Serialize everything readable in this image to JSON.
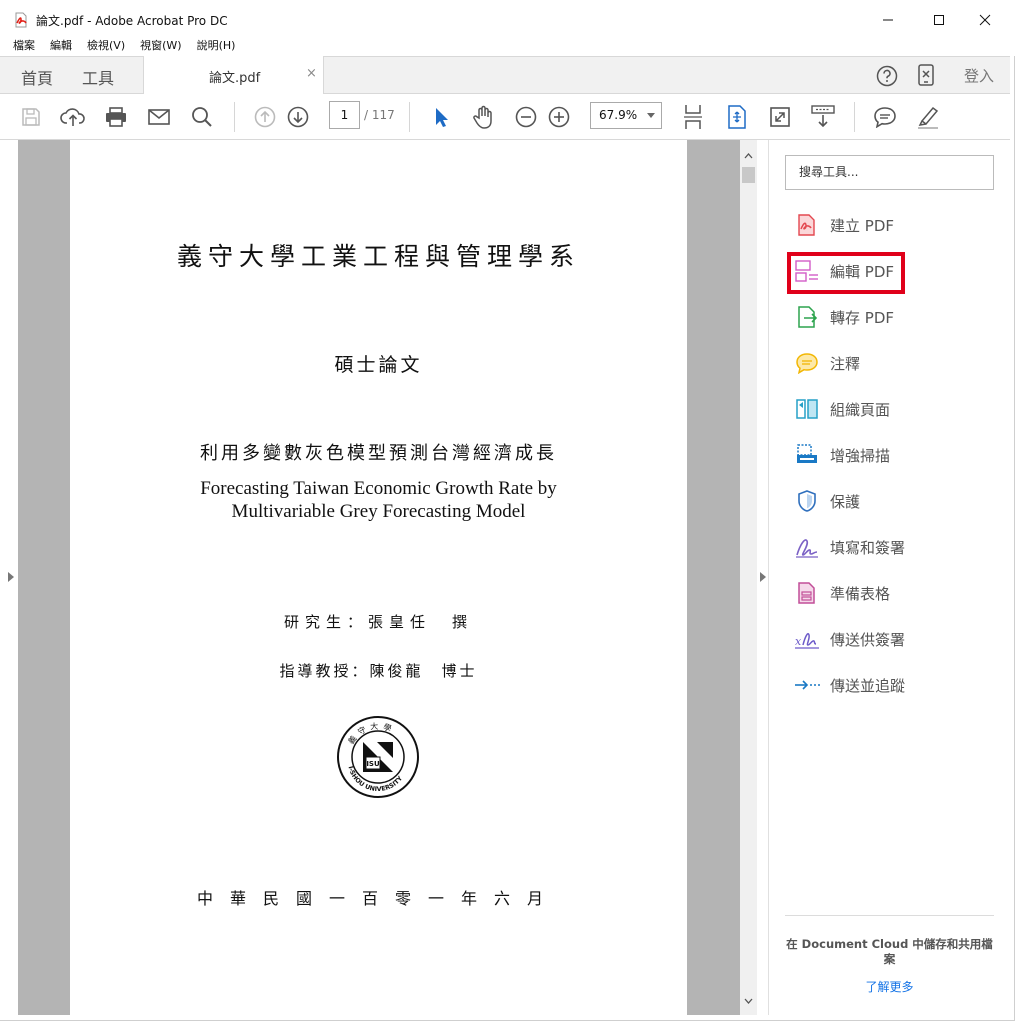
{
  "window": {
    "title": "論文.pdf - Adobe Acrobat Pro DC"
  },
  "menu": [
    "檔案",
    "編輯",
    "檢視(V)",
    "視窗(W)",
    "說明(H)"
  ],
  "tabs": {
    "home": "首頁",
    "tools": "工具",
    "document": "論文.pdf",
    "close": "×",
    "signin": "登入"
  },
  "toolbar": {
    "page_current": "1",
    "page_total": "/ 117",
    "zoom": "67.9%"
  },
  "document": {
    "university": "義守大學工業工程與管理學系",
    "thesis_type": "碩士論文",
    "title_zh": "利用多變數灰色模型預測台灣經濟成長",
    "title_en_line1": "Forecasting Taiwan Economic Growth Rate by",
    "title_en_line2": "Multivariable Grey Forecasting Model",
    "student": "研究生：張皇任　撰",
    "advisor": "指導教授：陳俊龍　博士",
    "date": "中華民國一百零一年六月",
    "seal": {
      "top_text": "義 守 大 學",
      "center_text": "ISU",
      "bottom_text": "I-SHOU UNIVERSITY"
    }
  },
  "tools_pane": {
    "search_placeholder": "搜尋工具...",
    "items": [
      {
        "label": "建立 PDF",
        "icon": "create-pdf-icon",
        "color": "#e34850"
      },
      {
        "label": "編輯 PDF",
        "icon": "edit-pdf-icon",
        "color": "#d25cc8"
      },
      {
        "label": "轉存 PDF",
        "icon": "export-pdf-icon",
        "color": "#2da44e"
      },
      {
        "label": "注釋",
        "icon": "comment-icon",
        "color": "#f2b705"
      },
      {
        "label": "組織頁面",
        "icon": "organize-pages-icon",
        "color": "#26a0c7"
      },
      {
        "label": "增強掃描",
        "icon": "enhance-scan-icon",
        "color": "#1a79c5"
      },
      {
        "label": "保護",
        "icon": "protect-icon",
        "color": "#2f6fbd"
      },
      {
        "label": "填寫和簽署",
        "icon": "fill-sign-icon",
        "color": "#7b61c5"
      },
      {
        "label": "準備表格",
        "icon": "prepare-form-icon",
        "color": "#c24e98"
      },
      {
        "label": "傳送供簽署",
        "icon": "send-for-signature-icon",
        "color": "#6d5bc9"
      },
      {
        "label": "傳送並追蹤",
        "icon": "send-track-icon",
        "color": "#1a79c5"
      }
    ],
    "cloud_text": "在 Document Cloud 中儲存和共用檔案",
    "learn_more": "了解更多"
  }
}
